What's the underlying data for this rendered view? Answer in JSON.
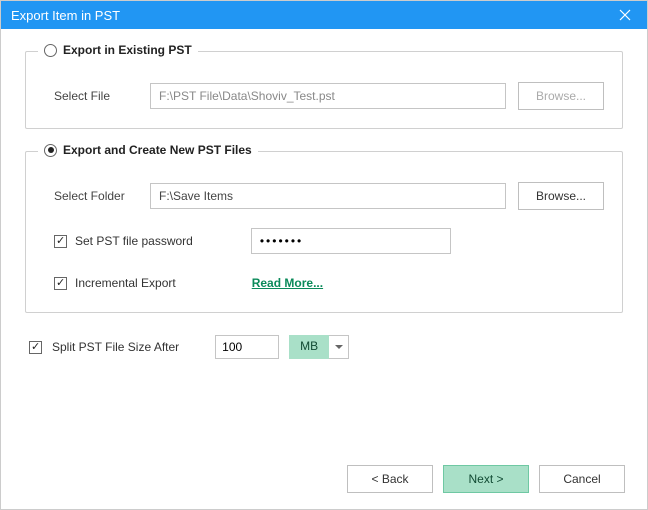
{
  "window": {
    "title": "Export Item in PST"
  },
  "groups": {
    "existing": {
      "legend": "Export in Existing PST",
      "selected": false,
      "file_label": "Select File",
      "file_value": "F:\\PST File\\Data\\Shoviv_Test.pst",
      "browse_label": "Browse..."
    },
    "create": {
      "legend": "Export and Create New  PST Files",
      "selected": true,
      "folder_label": "Select Folder",
      "folder_value": "F:\\Save Items",
      "browse_label": "Browse...",
      "password_checkbox_label": "Set PST file password",
      "password_checked": true,
      "password_value": "•••••••",
      "incremental_label": "Incremental Export",
      "incremental_checked": true,
      "read_more": "Read More..."
    }
  },
  "split": {
    "label": "Split PST File Size After",
    "checked": true,
    "size_value": "100",
    "unit": "MB"
  },
  "footer": {
    "back": "< Back",
    "next": "Next >",
    "cancel": "Cancel"
  }
}
